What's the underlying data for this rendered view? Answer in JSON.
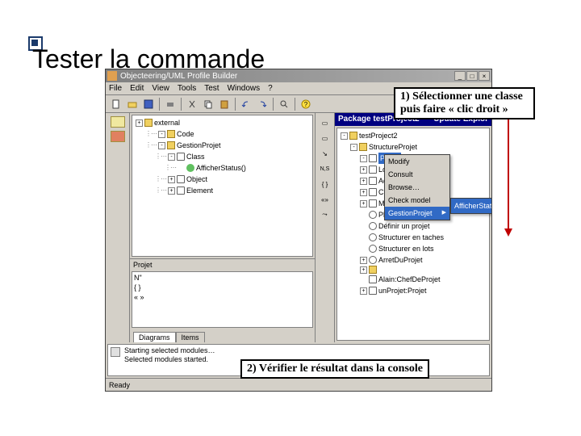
{
  "slide": {
    "title": "Tester la commande"
  },
  "window": {
    "title": "Objecteering/UML Profile Builder",
    "menus": [
      "File",
      "Edit",
      "View",
      "Tools",
      "Test",
      "Windows",
      "?"
    ],
    "status": "Ready"
  },
  "left_tree": {
    "items": [
      {
        "label": "external",
        "indent": 0,
        "exp": "+",
        "icon": "folder"
      },
      {
        "label": "Code",
        "indent": 1,
        "exp": "-",
        "icon": "folder"
      },
      {
        "label": "GestionProjet",
        "indent": 1,
        "exp": "-",
        "icon": "folder"
      },
      {
        "label": "Class",
        "indent": 2,
        "exp": "-",
        "icon": "class"
      },
      {
        "label": "AfficherStatus()",
        "indent": 3,
        "exp": "",
        "icon": "method"
      },
      {
        "label": "Object",
        "indent": 2,
        "exp": "+",
        "icon": "class"
      },
      {
        "label": "Element",
        "indent": 2,
        "exp": "+",
        "icon": "class"
      }
    ]
  },
  "projet_label": "Projet",
  "lower_items": [
    "N\"",
    "{ }",
    "« »"
  ],
  "tabs": [
    "Diagrams",
    "Items"
  ],
  "right_header": {
    "left": "Package testProject2",
    "right": "Update Explor"
  },
  "right_tree": {
    "items": [
      {
        "label": "testProject2",
        "indent": 0,
        "exp": "-",
        "icon": "folder"
      },
      {
        "label": "StructureProjet",
        "indent": 1,
        "exp": "-",
        "icon": "folder"
      },
      {
        "label": "Projet",
        "indent": 2,
        "exp": "-",
        "icon": "class",
        "selected": true
      },
      {
        "label": "Lot",
        "indent": 2,
        "exp": "+",
        "icon": "class"
      },
      {
        "label": "Activite",
        "indent": 2,
        "exp": "+",
        "icon": "class"
      },
      {
        "label": "ChefDeProjet",
        "indent": 2,
        "exp": "+",
        "icon": "class"
      },
      {
        "label": "MembreEquipe",
        "indent": 2,
        "exp": "+",
        "icon": "class"
      },
      {
        "label": "PlannifierProjet",
        "indent": 2,
        "exp": "",
        "icon": "oval"
      },
      {
        "label": "Définir un projet",
        "indent": 2,
        "exp": "",
        "icon": "oval"
      },
      {
        "label": "Structurer en taches",
        "indent": 2,
        "exp": "",
        "icon": "oval"
      },
      {
        "label": "Structurer en lots",
        "indent": 2,
        "exp": "",
        "icon": "oval"
      },
      {
        "label": "ArretDuProjet",
        "indent": 2,
        "exp": "+",
        "icon": "oval"
      },
      {
        "label": "",
        "indent": 2,
        "exp": "+",
        "icon": "folder"
      },
      {
        "label": "Alain:ChefDeProjet",
        "indent": 2,
        "exp": "",
        "icon": "obj"
      },
      {
        "label": "unProjet:Projet",
        "indent": 2,
        "exp": "+",
        "icon": "obj"
      }
    ]
  },
  "context_menu": {
    "items": [
      {
        "label": "Modify",
        "arrow": false
      },
      {
        "label": "Consult",
        "arrow": false
      },
      {
        "label": "Browse…",
        "arrow": false
      },
      {
        "label": "Check model",
        "arrow": false
      },
      {
        "label": "GestionProjet",
        "arrow": true,
        "hl": true
      }
    ]
  },
  "submenu": {
    "item": "AfficherStatus"
  },
  "console": {
    "lines": [
      "Starting selected modules…",
      "Selected modules started."
    ]
  },
  "callouts": {
    "c1_l1": "1) Sélectionner une classe",
    "c1_l2": "puis faire « clic droit »",
    "c2": "2) Vérifier le résultat dans la console"
  }
}
